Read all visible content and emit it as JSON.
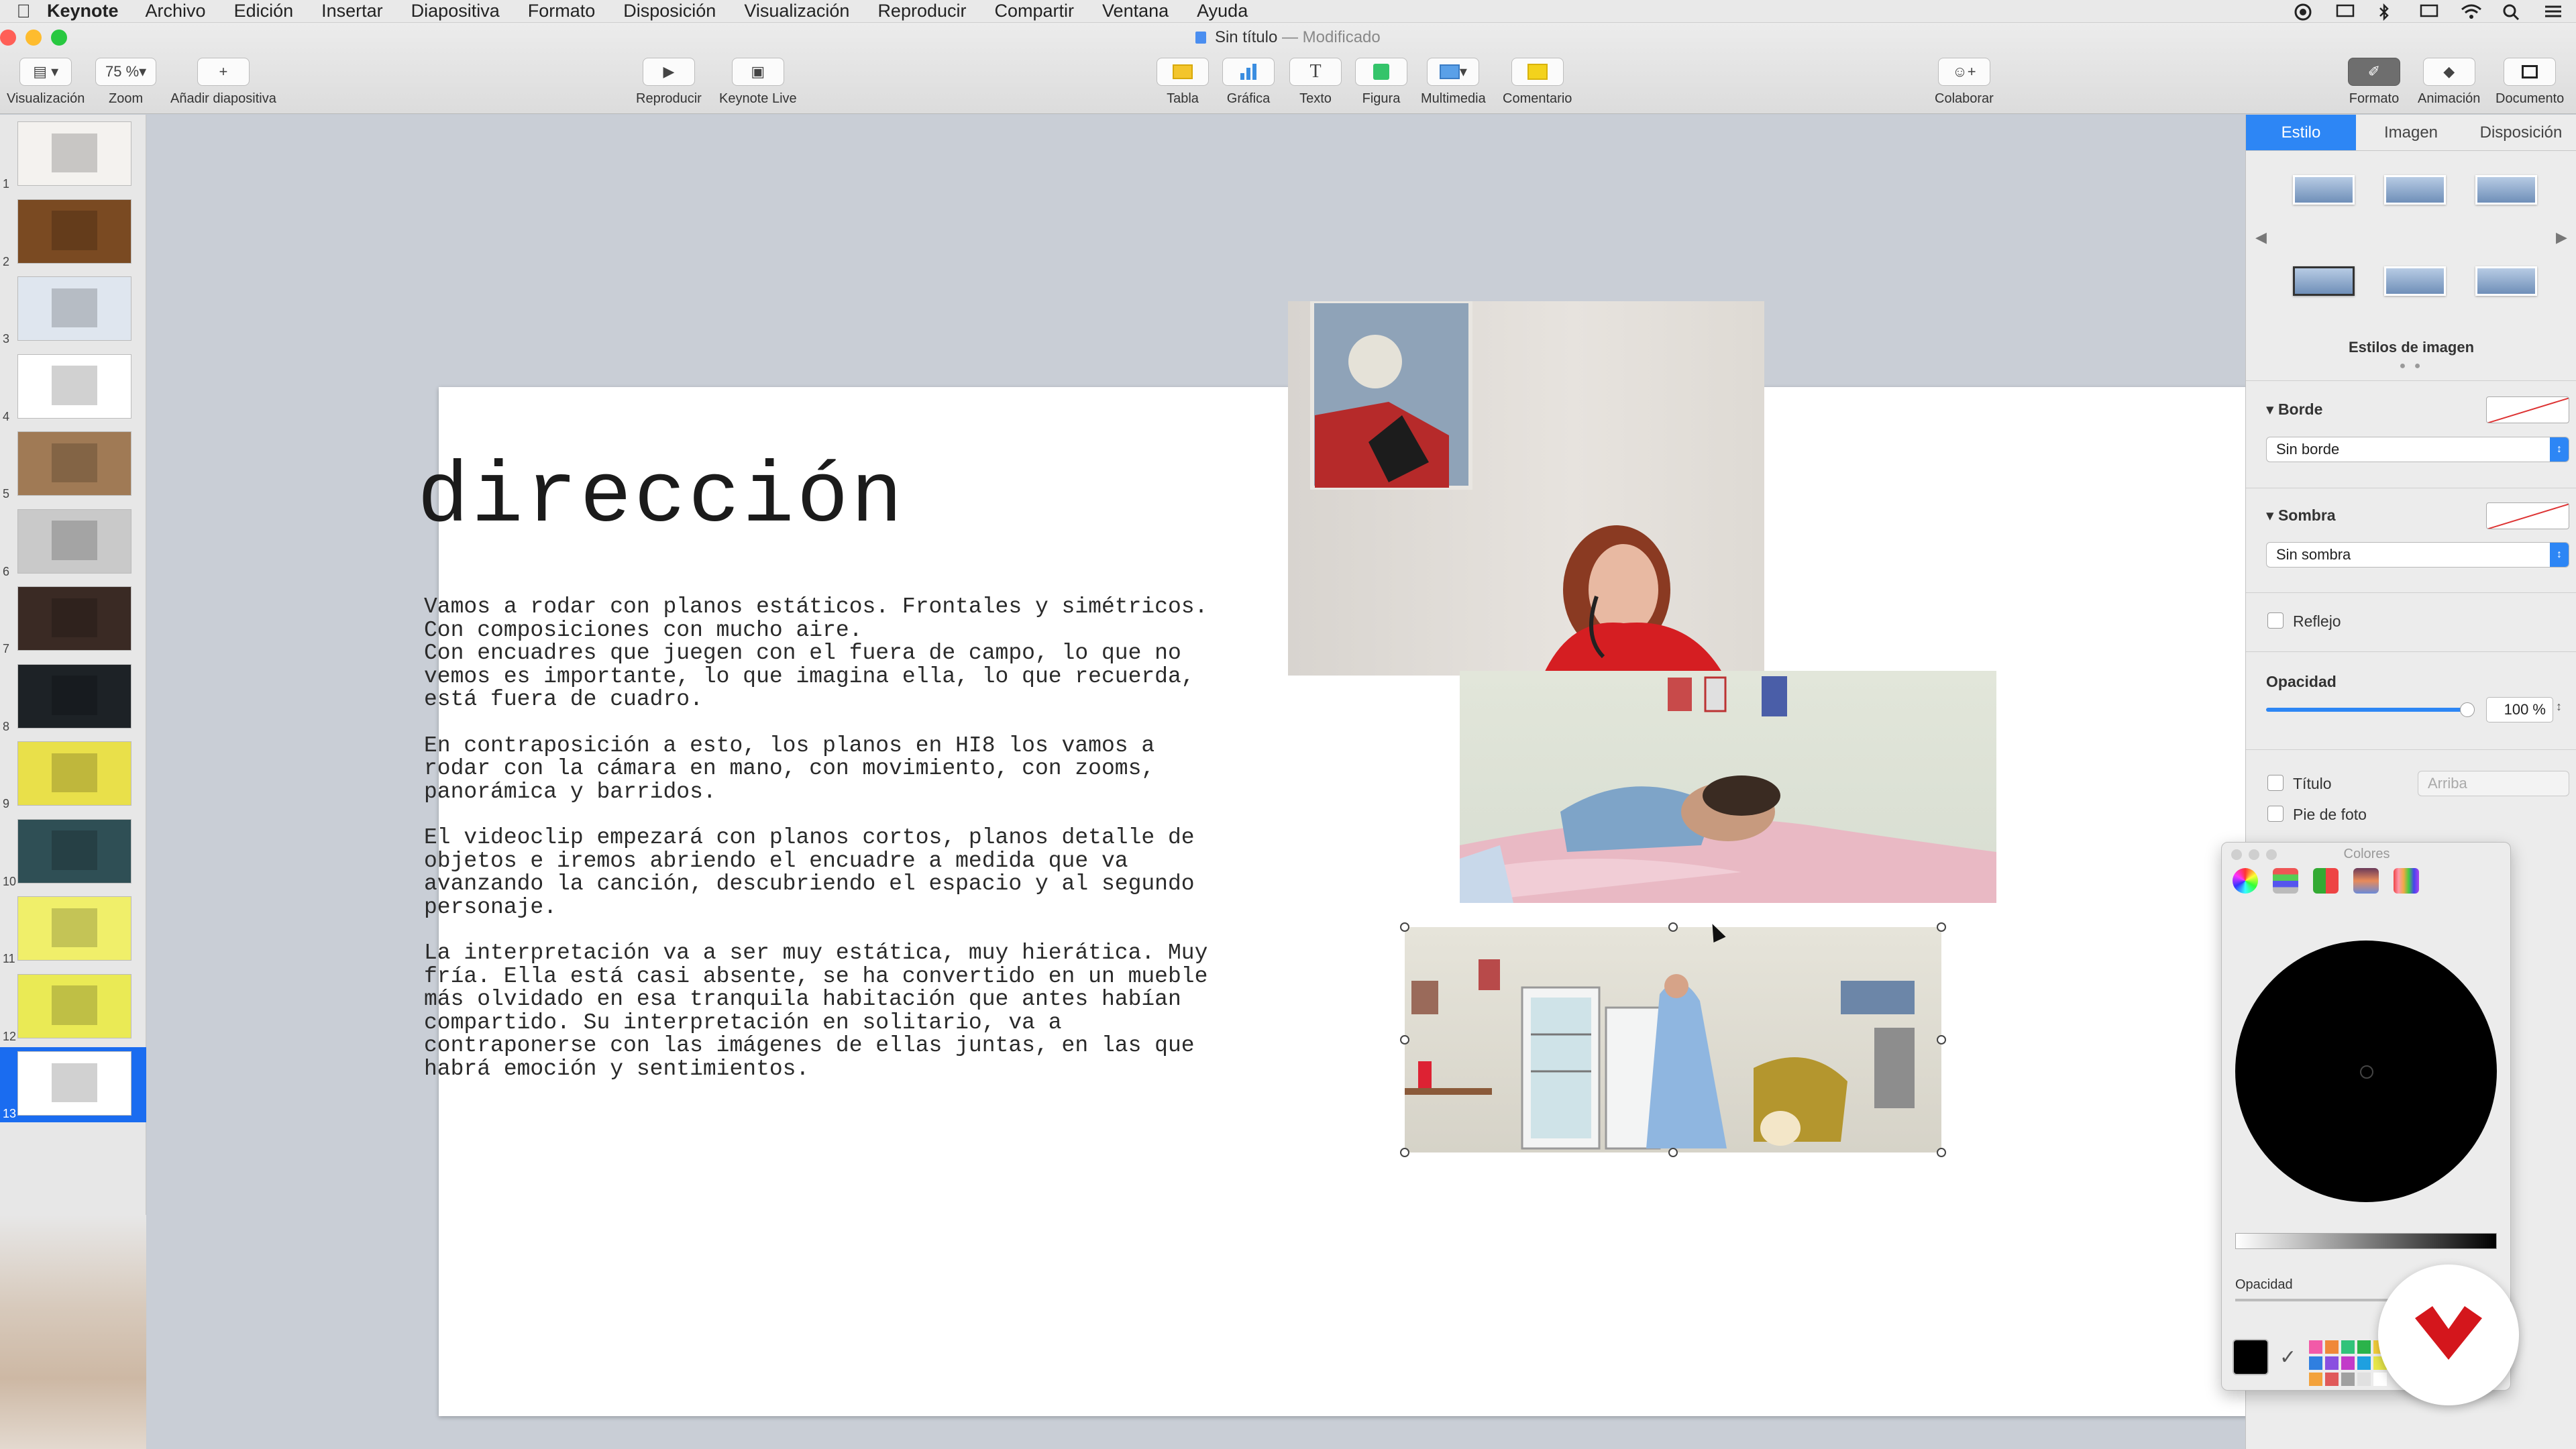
{
  "menubar": {
    "app_name": "Keynote",
    "items": [
      "Archivo",
      "Edición",
      "Insertar",
      "Diapositiva",
      "Formato",
      "Disposición",
      "Visualización",
      "Reproducir",
      "Compartir",
      "Ventana",
      "Ayuda"
    ]
  },
  "window": {
    "title": "Sin título",
    "status": "— Modificado"
  },
  "toolbar": {
    "view_label": "Visualización",
    "zoom_value": "75 %",
    "zoom_label": "Zoom",
    "add_slide_label": "Añadir diapositiva",
    "play_label": "Reproducir",
    "keynote_live_label": "Keynote Live",
    "table_label": "Tabla",
    "chart_label": "Gráfica",
    "text_label": "Texto",
    "shape_label": "Figura",
    "media_label": "Multimedia",
    "comment_label": "Comentario",
    "collaborate_label": "Colaborar",
    "format_label": "Formato",
    "animate_label": "Animación",
    "document_label": "Documento"
  },
  "navigator": {
    "slides": [
      "1",
      "2",
      "3",
      "4",
      "5",
      "6",
      "7",
      "8",
      "9",
      "10",
      "11",
      "12",
      "13"
    ],
    "selected": "13",
    "thumb_colors": [
      "#f4f2ef",
      "#7a4a22",
      "#dfe6ef",
      "#ffffff",
      "#a07a55",
      "#c9c9c9",
      "#3a2a24",
      "#1d2226",
      "#e9e04a",
      "#2f4f55",
      "#f0ef6a",
      "#eaea55",
      "#ffffff"
    ]
  },
  "slide": {
    "title": "dirección",
    "paragraphs": [
      "Vamos a rodar con planos estáticos. Frontales y simétricos.\nCon composiciones con mucho aire.\nCon encuadres que juegen con el fuera de campo, lo que no\nvemos es importante, lo que imagina ella, lo que recuerda,\nestá fuera de cuadro.",
      "En contraposición a esto, los planos en HI8 los vamos a\nrodar con la cámara en mano, con movimiento, con zooms,\npanorámica y barridos.",
      "El videoclip empezará con planos cortos, planos detalle de\nobjetos e iremos abriendo el encuadre a medida que va\navanzando la canción, descubriendo el espacio y al segundo\npersonaje.",
      "La interpretación va a ser muy estática, muy hierática. Muy\nfría. Ella está casi absente, se ha convertido en un mueble\nmás olvidado en esa tranquila habitación que antes habían\ncompartido. Su interpretación en solitario, va a\ncontraponerse con las imágenes de ellas juntas, en las que\nhabrá emoción y sentimientos."
    ]
  },
  "inspector": {
    "tabs": [
      "Estilo",
      "Imagen",
      "Disposición"
    ],
    "styles_caption": "Estilos de imagen",
    "border_head": "Borde",
    "border_value": "Sin borde",
    "shadow_head": "Sombra",
    "shadow_value": "Sin sombra",
    "reflection_label": "Reflejo",
    "opacity_head": "Opacidad",
    "opacity_value": "100 %",
    "opacity_fraction": 1.0,
    "title_label": "Título",
    "title_position": "Arriba",
    "caption_label": "Pie de foto"
  },
  "colors_panel": {
    "title": "Colores",
    "opacity_label": "Opacidad",
    "current_color": "#000000",
    "palette": [
      "#f25aa8",
      "#f0883a",
      "#31c37a",
      "#2bb34a",
      "#f7d13c",
      "#2f7fe0",
      "#8a4fe0",
      "#c23ac9",
      "#1ea0e0",
      "#e8e84a",
      "#f3a23c",
      "#e05a5a",
      "#a0a0a0",
      "#e0e0e0",
      "#ffffff"
    ]
  },
  "accent": "#2d86f5"
}
